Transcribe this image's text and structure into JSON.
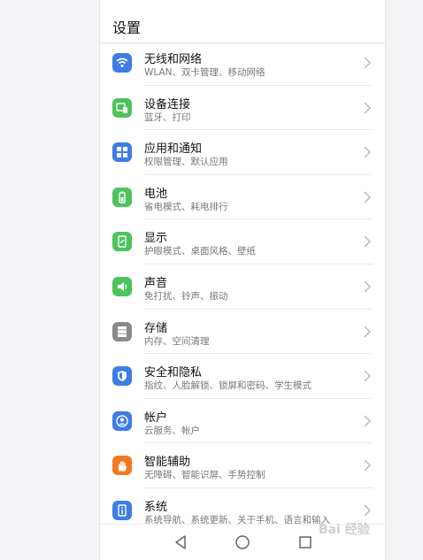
{
  "header": {
    "title": "设置"
  },
  "settings": {
    "items": [
      {
        "title": "无线和网络",
        "subtitle": "WLAN、双卡管理、移动网络",
        "icon": "wifi-icon",
        "color": "#3d7de5"
      },
      {
        "title": "设备连接",
        "subtitle": "蓝牙、打印",
        "icon": "device-connect-icon",
        "color": "#4cc35b"
      },
      {
        "title": "应用和通知",
        "subtitle": "权限管理、默认应用",
        "icon": "apps-grid-icon",
        "color": "#3d7de5"
      },
      {
        "title": "电池",
        "subtitle": "省电模式、耗电排行",
        "icon": "battery-icon",
        "color": "#4cc35b"
      },
      {
        "title": "显示",
        "subtitle": "护眼模式、桌面风格、壁纸",
        "icon": "display-icon",
        "color": "#4cc35b"
      },
      {
        "title": "声音",
        "subtitle": "免打扰、铃声、振动",
        "icon": "speaker-icon",
        "color": "#4cc35b"
      },
      {
        "title": "存储",
        "subtitle": "内存、空间清理",
        "icon": "storage-icon",
        "color": "#8a8a8a"
      },
      {
        "title": "安全和隐私",
        "subtitle": "指纹、人脸解锁、锁屏和密码、学生模式",
        "icon": "shield-icon",
        "color": "#3d7de5"
      },
      {
        "title": "帐户",
        "subtitle": "云服务、帐户",
        "icon": "account-icon",
        "color": "#3d7de5"
      },
      {
        "title": "智能辅助",
        "subtitle": "无障碍、智能识屏、手势控制",
        "icon": "hand-icon",
        "color": "#f07a23"
      },
      {
        "title": "系统",
        "subtitle": "系统导航、系统更新、关于手机、语言和输入",
        "icon": "system-info-icon",
        "color": "#3d7de5"
      }
    ]
  },
  "navigation": {
    "buttons": [
      {
        "name": "back-nav-icon"
      },
      {
        "name": "home-nav-icon"
      },
      {
        "name": "recents-nav-icon"
      }
    ]
  },
  "watermark": {
    "text": "Bai 经验"
  }
}
